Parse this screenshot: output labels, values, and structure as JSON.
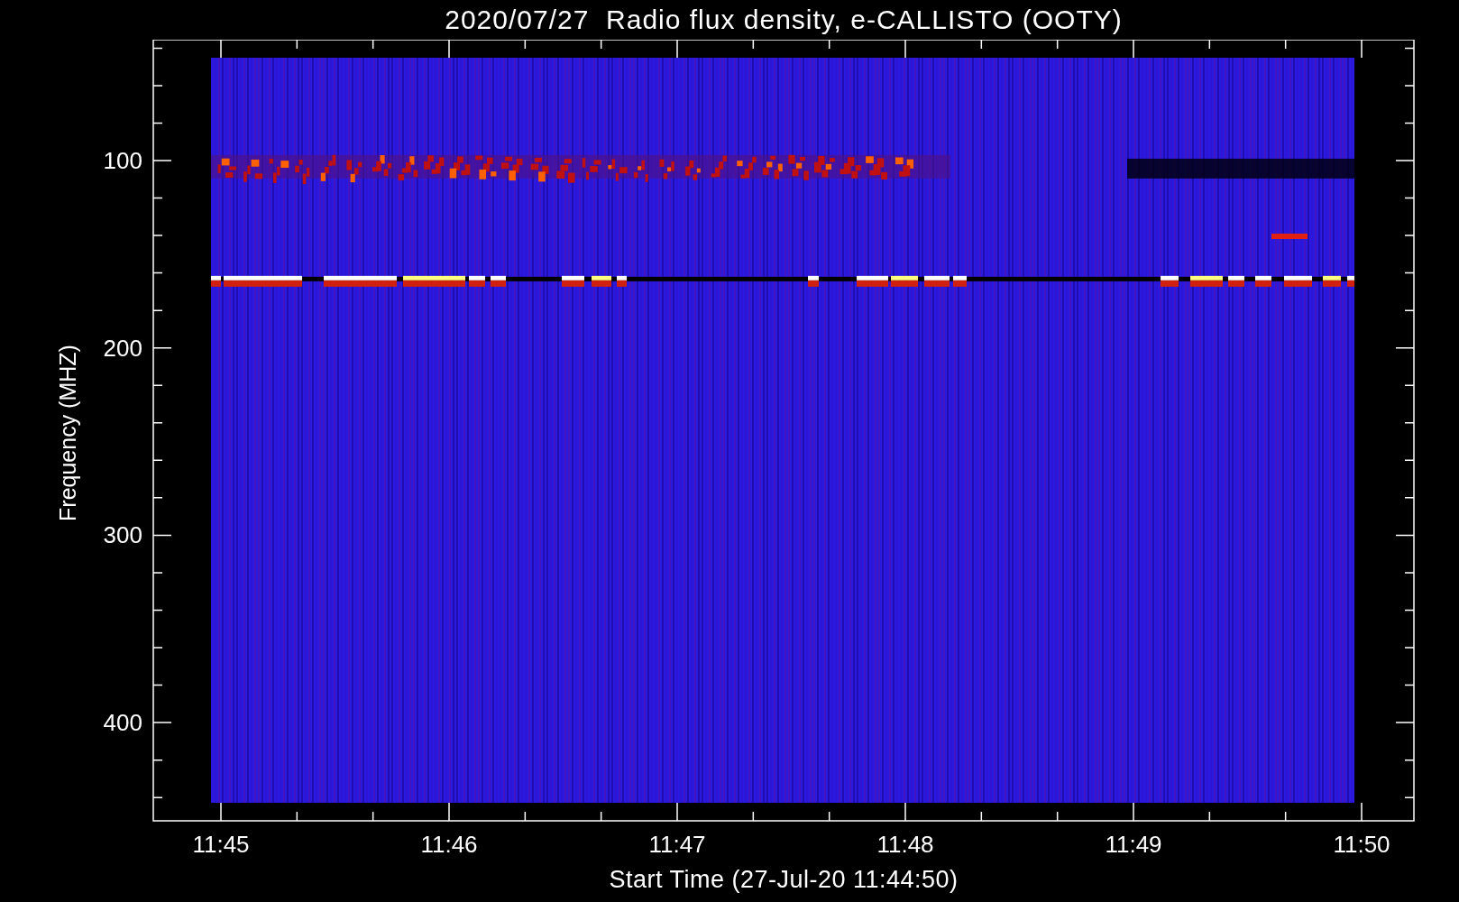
{
  "title": "2020/07/27  Radio flux density, e-CALLISTO (OOTY)",
  "chart": {
    "ylabel": "Frequency (MHZ)",
    "xlabel": "Start Time (27-Jul-20 11:44:50)",
    "yticks": [
      "100",
      "200",
      "300",
      "400"
    ],
    "xticks": [
      "11:45",
      "11:46",
      "11:47",
      "11:48",
      "11:49",
      "11:50"
    ]
  }
}
